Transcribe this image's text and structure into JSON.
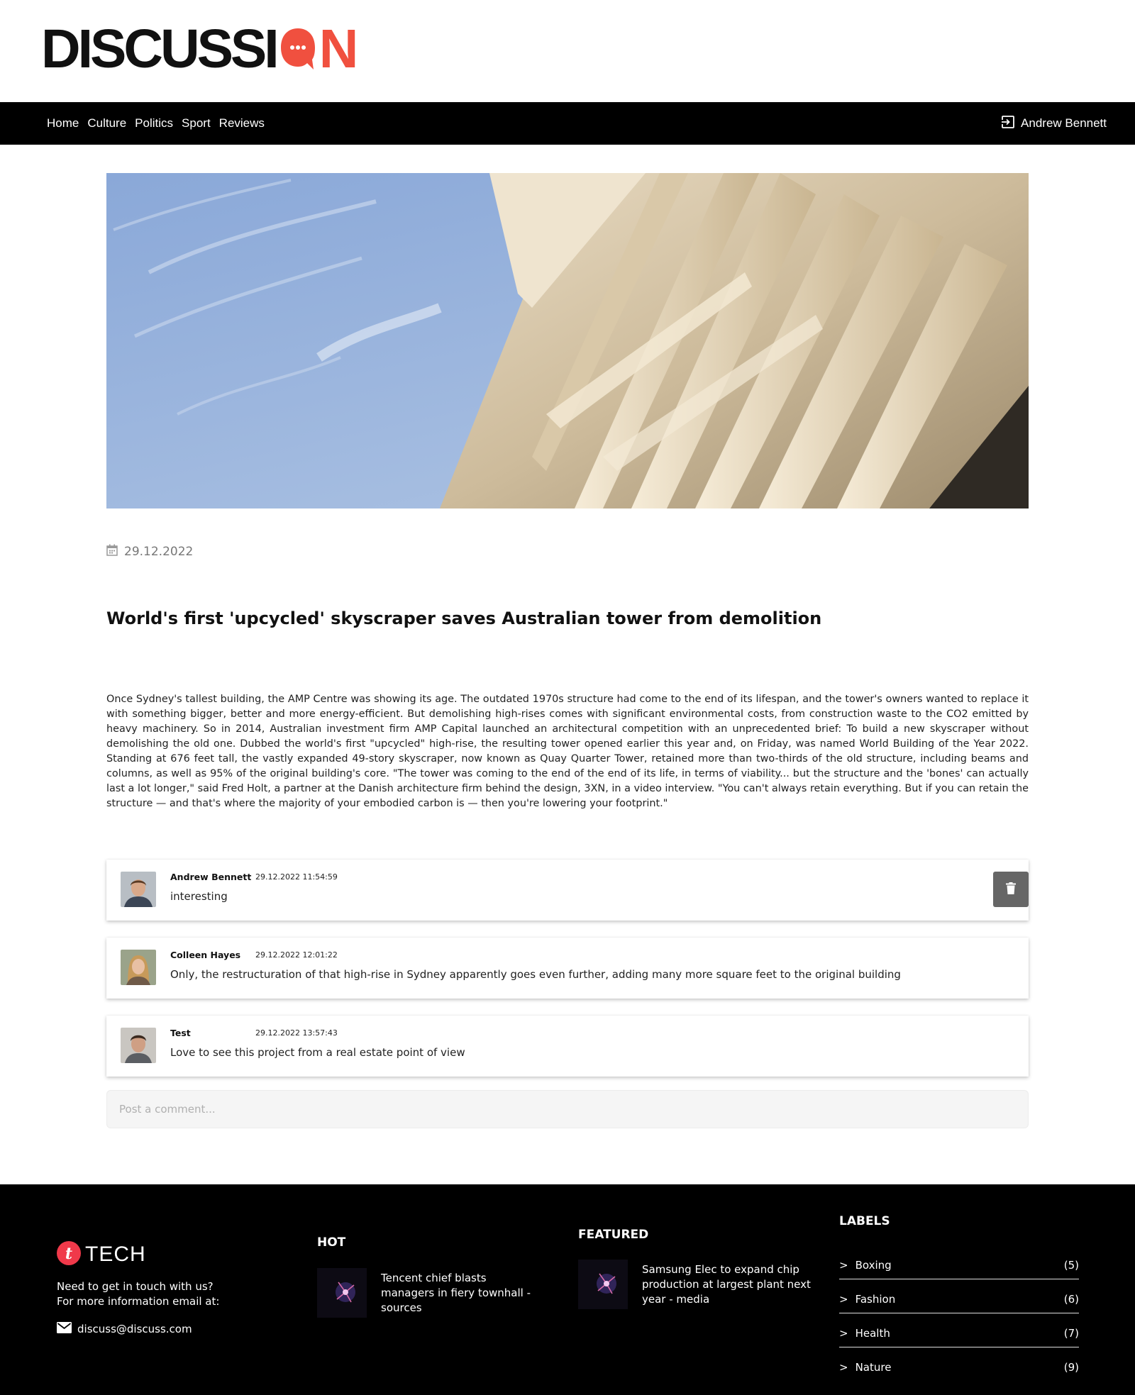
{
  "brand": {
    "logo_pre": "DISCUSSI",
    "logo_post": "N",
    "accent_color": "#f0503f"
  },
  "nav": {
    "links": [
      "Home",
      "Culture",
      "Politics",
      "Sport",
      "Reviews"
    ],
    "user_name": "Andrew Bennett",
    "user_icon": "login-icon"
  },
  "article": {
    "date": "29.12.2022",
    "date_icon": "calendar-icon",
    "title": "World's first 'upcycled' skyscraper saves Australian tower from demolition",
    "body": "Once Sydney's tallest building, the AMP Centre was showing its age. The outdated 1970s structure had come to the end of its lifespan, and the tower's owners wanted to replace it with something bigger, better and more energy-efficient. But demolishing high-rises comes with significant environmental costs, from construction waste to the CO2 emitted by heavy machinery. So in 2014, Australian investment firm AMP Capital launched an architectural competition with an unprecedented brief: To build a new skyscraper without demolishing the old one. Dubbed the world's first \"upcycled\" high-rise, the resulting tower opened earlier this year and, on Friday, was named World Building of the Year 2022. Standing at 676 feet tall, the vastly expanded 49-story skyscraper, now known as Quay Quarter Tower, retained more than two-thirds of the old structure, including beams and columns, as well as 95% of the original building's core. \"The tower was coming to the end of the end of its life, in terms of viability... but the structure and the 'bones' can actually last a lot longer,\" said Fred Holt, a partner at the Danish architecture firm behind the design, 3XN, in a video interview. \"You can't always retain everything. But if you can retain the structure — and that's where the majority of your embodied carbon is — then you're lowering your footprint.\""
  },
  "comments": [
    {
      "author": "Andrew Bennett",
      "time": "29.12.2022 11:54:59",
      "text": "interesting",
      "deletable": true
    },
    {
      "author": "Colleen Hayes",
      "time": "29.12.2022 12:01:22",
      "text": "Only, the restructuration of that high-rise in Sydney apparently goes even further, adding many more square feet to the original building",
      "deletable": false
    },
    {
      "author": "Test",
      "time": "29.12.2022 13:57:43",
      "text": "Love to see this project from a real estate point of view",
      "deletable": false
    }
  ],
  "comment_input": {
    "placeholder": "Post a comment..."
  },
  "footer": {
    "logo_letter": "t",
    "logo_text": "TECH",
    "contact_line1": "Need to get in touch with us?",
    "contact_line2": "For more information email at:",
    "email": "discuss@discuss.com",
    "hot": {
      "heading": "HOT",
      "post_title": "Tencent chief blasts managers in fiery townhall - sources"
    },
    "featured": {
      "heading": "FEATURED",
      "post_title": "Samsung Elec to expand chip production at largest plant next year - media"
    },
    "labels": {
      "heading": "LABELS",
      "items": [
        {
          "name": "Boxing",
          "count": "(5)"
        },
        {
          "name": "Fashion",
          "count": "(6)"
        },
        {
          "name": "Health",
          "count": "(7)"
        },
        {
          "name": "Nature",
          "count": "(9)"
        }
      ]
    }
  }
}
